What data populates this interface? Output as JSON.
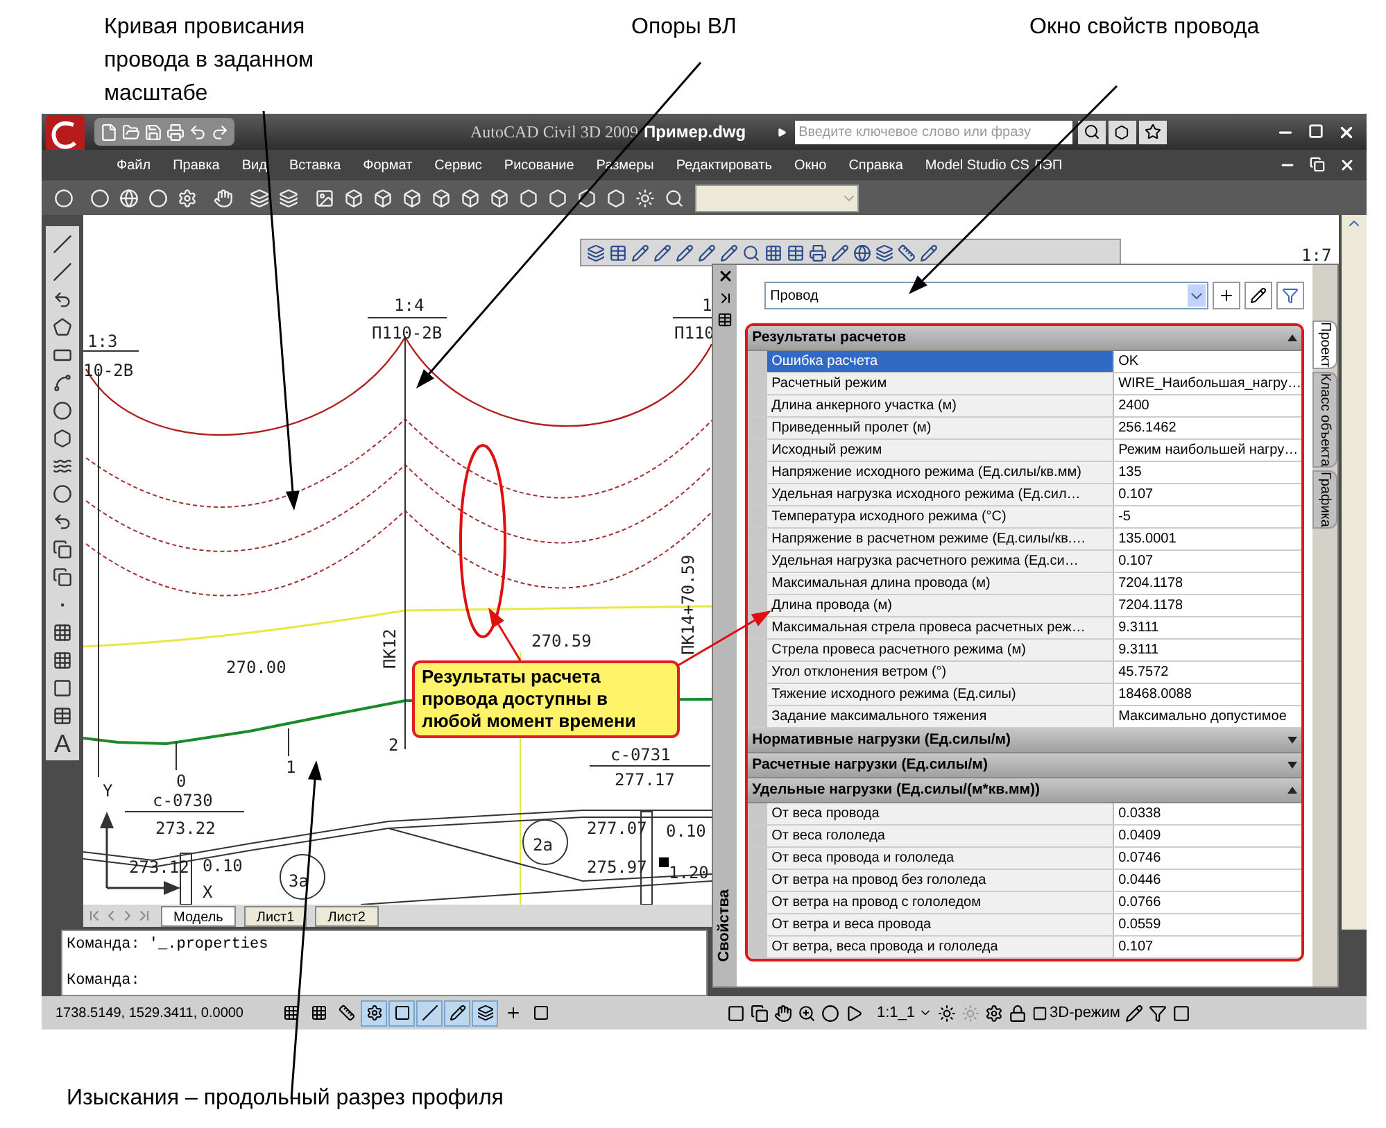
{
  "captions": [
    {
      "text": "Кривая провисания провода в заданном масштабе"
    },
    {
      "text": "Опоры ВЛ"
    },
    {
      "text": "Окно свойств провода"
    },
    {
      "text": "Изыскания – продольный разрез профиля"
    }
  ],
  "window": {
    "title": "AutoCAD Civil 3D 2009",
    "document": "Пример.dwg",
    "search_placeholder": "Введите ключевое слово или фразу"
  },
  "menu": [
    "Файл",
    "Правка",
    "Вид",
    "Вставка",
    "Формат",
    "Сервис",
    "Рисование",
    "Размеры",
    "Редактировать",
    "Окно",
    "Справка",
    "Model Studio CS ЛЭП"
  ],
  "left_toolbar": {
    "text_tool": "A"
  },
  "drawing": {
    "labels": [
      {
        "text": "1:3"
      },
      {
        "text": "10-2В"
      },
      {
        "text": "1:4"
      },
      {
        "text": "П110-2В"
      },
      {
        "text": "1"
      },
      {
        "text": "П110"
      },
      {
        "text": "1:7"
      },
      {
        "text": "ПК12"
      },
      {
        "text": "270.00"
      },
      {
        "text": "270.59"
      },
      {
        "text": "ПК14+70.59"
      },
      {
        "text": "0"
      },
      {
        "text": "1"
      },
      {
        "text": "2"
      },
      {
        "text": "с-0731"
      },
      {
        "text": "277.17"
      },
      {
        "text": "Y"
      },
      {
        "text": "с-0730"
      },
      {
        "text": "273.22"
      },
      {
        "text": "277.07"
      },
      {
        "text": "0.10"
      },
      {
        "text": "2а"
      },
      {
        "text": "273.12"
      },
      {
        "text": "0.10"
      },
      {
        "text": "275.97"
      },
      {
        "text": "1.20"
      },
      {
        "text": "3а"
      },
      {
        "text": "X"
      }
    ],
    "callout": "Результаты расчета провода доступны в любой момент времени",
    "tabs": [
      {
        "label": "Модель",
        "selected": true
      },
      {
        "label": "Лист1",
        "selected": false
      },
      {
        "label": "Лист2",
        "selected": false
      }
    ]
  },
  "properties": {
    "title": "Свойства",
    "object_type": "Провод",
    "sections": [
      {
        "title": "Результаты расчетов",
        "expanded": true,
        "rows": [
          {
            "name": "Ошибка расчета",
            "value": "OK",
            "selected": true
          },
          {
            "name": "Расчетный режим",
            "value": "WIRE_Наибольшая_нагру…",
            "selected": false
          },
          {
            "name": "Длина анкерного участка (м)",
            "value": "2400",
            "selected": false
          },
          {
            "name": "Приведенный пролет (м)",
            "value": "256.1462",
            "selected": false
          },
          {
            "name": "Исходный режим",
            "value": "Режим наибольшей нагру…",
            "selected": false
          },
          {
            "name": "Напряжение исходного режима (Ед.силы/кв.мм)",
            "value": "135",
            "selected": false
          },
          {
            "name": "Удельная нагрузка исходного режима (Ед.сил…",
            "value": "0.107",
            "selected": false
          },
          {
            "name": "Температура исходного режима (°C)",
            "value": "-5",
            "selected": false
          },
          {
            "name": "Напряжение в расчетном режиме (Ед.силы/кв.…",
            "value": "135.0001",
            "selected": false
          },
          {
            "name": "Удельная нагрузка расчетного режима (Ед.си…",
            "value": "0.107",
            "selected": false
          },
          {
            "name": "Максимальная длина провода (м)",
            "value": "7204.1178",
            "selected": false
          },
          {
            "name": "Длина провода (м)",
            "value": "7204.1178",
            "selected": false
          },
          {
            "name": "Максимальная стрела провеса расчетных реж…",
            "value": "9.3111",
            "selected": false
          },
          {
            "name": "Стрела провеса расчетного режима (м)",
            "value": "9.3111",
            "selected": false
          },
          {
            "name": "Угол отклонения ветром (°)",
            "value": "45.7572",
            "selected": false
          },
          {
            "name": "Тяжение исходного режима (Ед.силы)",
            "value": "18468.0088",
            "selected": false
          },
          {
            "name": "Задание максимального тяжения",
            "value": "Максимально допустимое",
            "selected": false
          }
        ]
      },
      {
        "title": "Нормативные нагрузки (Ед.силы/м)",
        "expanded": false
      },
      {
        "title": "Расчетные нагрузки (Ед.силы/м)",
        "expanded": false
      },
      {
        "title": "Удельные нагрузки (Ед.силы/(м*кв.мм))",
        "expanded": true,
        "rows": [
          {
            "name": "От веса провода",
            "value": "0.0338",
            "selected": false
          },
          {
            "name": "От веса гололеда",
            "value": "0.0409",
            "selected": false
          },
          {
            "name": "От веса провода и гололеда",
            "value": "0.0746",
            "selected": false
          },
          {
            "name": "От ветра на провод без гололеда",
            "value": "0.0446",
            "selected": false
          },
          {
            "name": "От ветра на провод с гололедом",
            "value": "0.0766",
            "selected": false
          },
          {
            "name": "От ветра и веса провода",
            "value": "0.0559",
            "selected": false
          },
          {
            "name": "От ветра, веса провода и гололеда",
            "value": "0.107",
            "selected": false
          }
        ]
      }
    ],
    "side_tabs": [
      {
        "label": "Проект",
        "selected": true
      },
      {
        "label": "Класс объекта",
        "selected": false
      },
      {
        "label": "Графика",
        "selected": false
      }
    ]
  },
  "command_lines": [
    "Команда: '_.properties",
    "Команда:"
  ],
  "status": {
    "coordinates": "1738.5149, 1529.3411, 0.0000",
    "toggles": [
      {
        "on": false
      },
      {
        "on": false
      },
      {
        "on": false
      },
      {
        "on": true
      },
      {
        "on": true
      },
      {
        "on": true
      },
      {
        "on": true
      },
      {
        "on": true
      },
      {
        "on": false
      },
      {
        "on": false
      }
    ],
    "scale": "1:1_1",
    "mode": "3D-режим"
  }
}
